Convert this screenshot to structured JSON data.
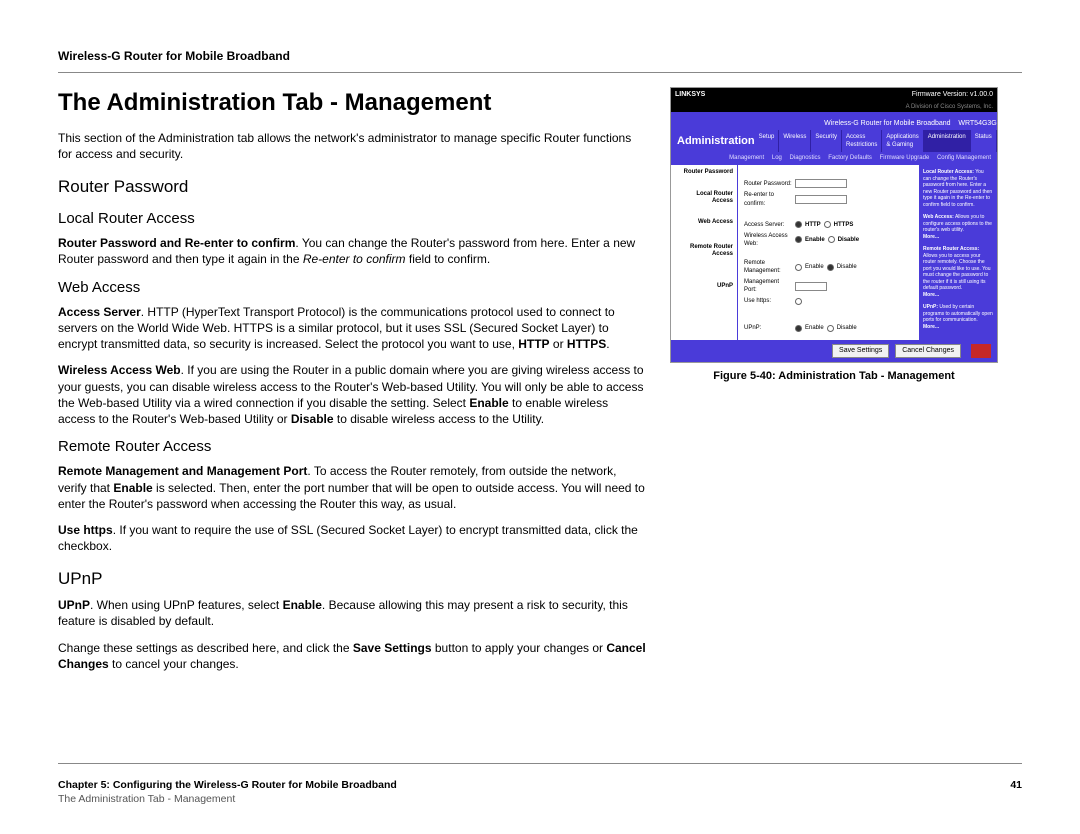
{
  "header": "Wireless-G Router for Mobile Broadband",
  "title": "The Administration Tab - Management",
  "intro": "This section of the Administration tab allows the network's administrator to manage specific Router functions for access and security.",
  "s1": "Router Password",
  "s1a": "Local Router Access",
  "p1_b": "Router Password and Re-enter to confirm",
  "p1_rest": ". You can change the Router's password from here. Enter a new Router password and then type it again in the ",
  "p1_i": "Re-enter to confirm",
  "p1_end": " field to confirm.",
  "s1b": "Web Access",
  "p2_b": "Access Server",
  "p2_rest": ". HTTP (HyperText Transport Protocol) is the communications protocol used to connect to servers on the World Wide Web. HTTPS is a similar protocol, but it uses SSL (Secured Socket Layer) to encrypt transmitted data, so security is increased. Select the protocol you want to use, ",
  "p2_b2": "HTTP",
  "p2_mid": " or ",
  "p2_b3": "HTTPS",
  "p2_end": ".",
  "p3_b": "Wireless Access Web",
  "p3_rest": ". If you are using the Router in a public domain where you are giving wireless access to your guests, you can disable wireless access to the Router's Web-based Utility. You will only be able to access the Web-based Utility via a wired connection if you disable the setting. Select ",
  "p3_b2": "Enable",
  "p3_mid": " to enable wireless access to the Router's Web-based Utility or ",
  "p3_b3": "Disable",
  "p3_end": " to disable wireless access to the Utility.",
  "s1c": "Remote Router Access",
  "p4_b": "Remote Management and Management Port",
  "p4_rest": ". To access the Router remotely, from outside the network, verify that ",
  "p4_b2": "Enable",
  "p4_end": " is selected. Then, enter the port number that will be open to outside access. You will need to enter the Router's password when accessing the Router this way, as usual.",
  "p5_b": "Use https",
  "p5_rest": ". If you want to require the use of SSL (Secured Socket Layer) to encrypt transmitted data, click the checkbox.",
  "s2": "UPnP",
  "p6_b": "UPnP",
  "p6_rest": ". When using UPnP features, select ",
  "p6_b2": "Enable",
  "p6_end": ". Because allowing this may present a risk to security, this feature is disabled by default.",
  "p7_a": "Change these settings as described here, and click the ",
  "p7_b": "Save Settings",
  "p7_mid": " button to apply your changes or ",
  "p7_b2": "Cancel Changes",
  "p7_end": " to cancel your changes.",
  "figcap": "Figure 5-40: Administration Tab - Management",
  "router": {
    "brand": "LINKSYS",
    "sub": "A Division of Cisco Systems, Inc.",
    "fw": "Firmware Version: v1.00.0",
    "product": "Wireless-G Router for Mobile Broadband",
    "model": "WRT54G3G",
    "admin": "Administration",
    "tabs": [
      "Setup",
      "Wireless",
      "Security",
      "Access Restrictions",
      "Applications & Gaming",
      "Administration",
      "Status"
    ],
    "subtabs": [
      "Management",
      "Log",
      "Diagnostics",
      "Factory Defaults",
      "Firmware Upgrade",
      "Config Management"
    ],
    "leftnav": [
      "Router Password",
      "Local Router Access",
      "Web Access",
      "Remote Router Access",
      "UPnP"
    ],
    "labels": {
      "rpw": "Router Password:",
      "re": "Re-enter to confirm:",
      "as": "Access Server:",
      "http": "HTTP",
      "https": "HTTPS",
      "waw": "Wireless Access Web:",
      "enable": "Enable",
      "disable": "Disable",
      "rm": "Remote Management:",
      "mp": "Management Port:",
      "uh": "Use https:",
      "upnp": "UPnP:"
    },
    "help": {
      "h1b": "Local Router Access:",
      "h1": " You can change the Router's password from here. Enter a new Router password and then type it again in the Re-enter to confirm field to confirm.",
      "h2b": "Web Access:",
      "h2": " Allows you to configure access options to the router's web utility.",
      "more1": "More...",
      "h3b": "Remote Router Access:",
      "h3": " Allows you to access your router remotely. Choose the port you would like to use. You must change the password to the router if it is still using its default password.",
      "more2": "More...",
      "h4b": "UPnP:",
      "h4": " Used by certain programs to automatically open ports for communication.",
      "more3": "More..."
    },
    "save": "Save Settings",
    "cancel": "Cancel Changes"
  },
  "footer": {
    "chapter": "Chapter 5: Configuring the Wireless-G Router for Mobile Broadband",
    "page": "41",
    "sub": "The Administration Tab - Management"
  }
}
